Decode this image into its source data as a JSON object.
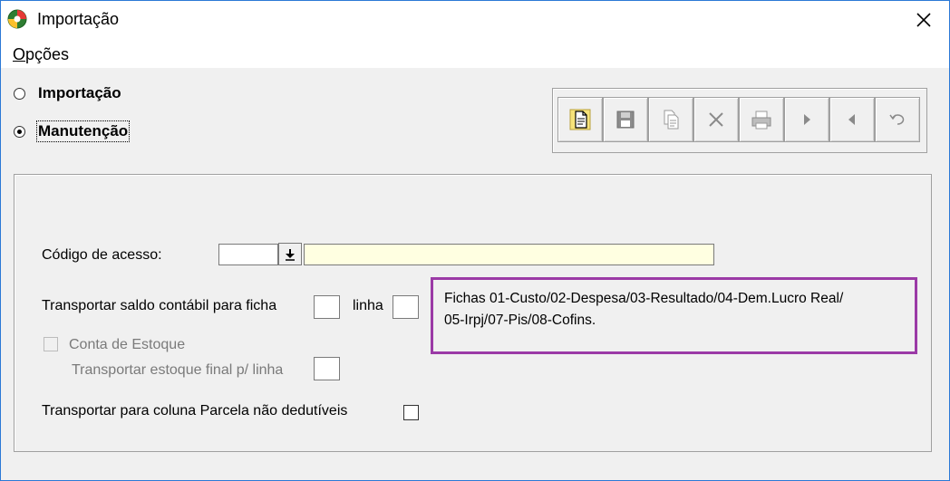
{
  "window": {
    "title": "Importação",
    "icon": "globe-app-icon"
  },
  "menu": {
    "options_prefix": "O",
    "options_rest": "pções"
  },
  "mode": {
    "import_label": "Importação",
    "maintenance_label": "Manutenção",
    "selected": "maintenance"
  },
  "toolbar": {
    "buttons": [
      "new-document-icon",
      "save-icon",
      "copy-icon",
      "delete-icon",
      "print-icon",
      "next-icon",
      "previous-icon",
      "undo-icon"
    ]
  },
  "form": {
    "access_code_label": "Código de acesso:",
    "access_code_value": "",
    "access_code_description": "",
    "transfer_balance_label": "Transportar saldo contábil para ficha",
    "line_label": "linha",
    "stock_account_label": "Conta de Estoque",
    "transfer_stock_label": "Transportar estoque final p/ linha",
    "non_deductible_label": "Transportar para coluna Parcela não dedutíveis"
  },
  "note": {
    "line1": "Fichas 01-Custo/02-Despesa/03-Resultado/04-Dem.Lucro Real/",
    "line2": "05-Irpj/07-Pis/08-Cofins.",
    "border_color": "#9b3aa6"
  }
}
